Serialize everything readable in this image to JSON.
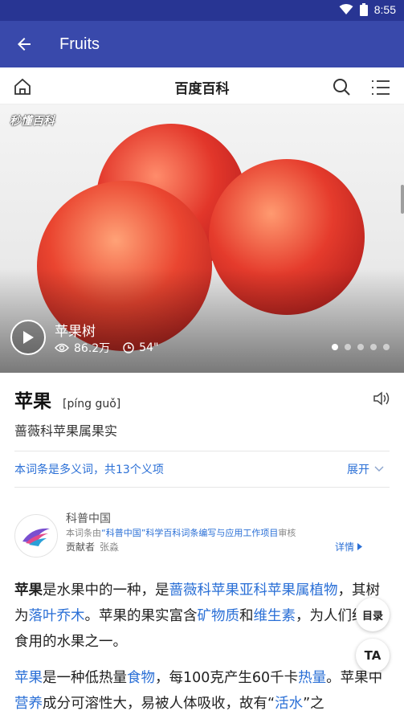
{
  "status": {
    "time": "8:55"
  },
  "appbar": {
    "title": "Fruits"
  },
  "site": {
    "brand": "百度百科"
  },
  "hero": {
    "logo": "秒懂百科",
    "video_title": "苹果树",
    "views": "86.2万",
    "duration": "54\"",
    "dots_total": 5,
    "dots_active": 1
  },
  "entry": {
    "word": "苹果",
    "pinyin": "[píng guǒ]",
    "description": "蔷薇科苹果属果实",
    "polysemy_note": "本词条是多义词，共13个义项",
    "expand_label": "展开"
  },
  "org": {
    "name": "科普中国",
    "note_prefix": "本词条由",
    "note_highlight": "“科普中国”科学百科词条编写与应用工作项目",
    "note_suffix": "审核",
    "contributor_label": "贡献者",
    "contributor_name": "张淼",
    "details_label": "详情"
  },
  "para1": {
    "p1": "苹果",
    "p2": "是水果中的一种，是",
    "p3": "蔷薇科苹果亚科苹果属植物",
    "p4": "，其树为",
    "p5": "落叶乔木",
    "p6": "。苹果的果实富含",
    "p7": "矿物质",
    "p8": "和",
    "p9": "维生素",
    "p10": "，为人们经常食用的水果之一。"
  },
  "para2": {
    "p1": "苹果",
    "p2": "是一种低热量",
    "p3": "食物",
    "p4": "，每100克产生60千卡",
    "p5": "热量",
    "p6": "。苹果中",
    "p7": "营养",
    "p8": "成分可溶性大，易被人体吸收，故有“",
    "p9": "活水",
    "p10": "”之"
  },
  "fabs": {
    "toc": "目录",
    "font": "TA"
  }
}
